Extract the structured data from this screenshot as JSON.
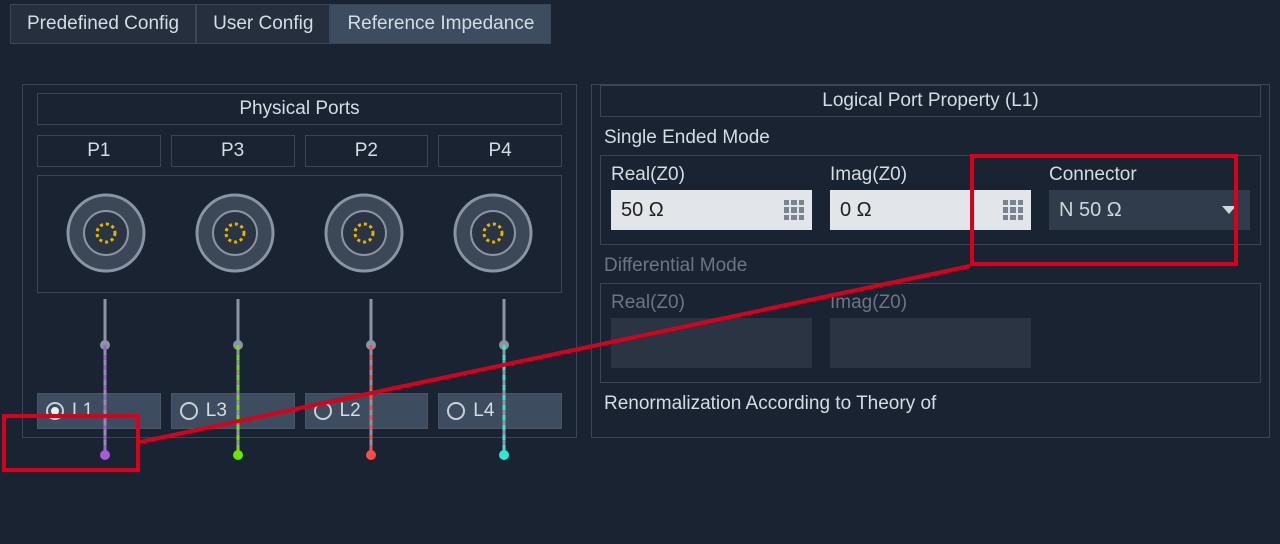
{
  "tabs": [
    {
      "label": "Predefined Config",
      "active": false
    },
    {
      "label": "User Config",
      "active": false
    },
    {
      "label": "Reference Impedance",
      "active": true
    }
  ],
  "physical_ports": {
    "title": "Physical Ports",
    "ports": [
      "P1",
      "P3",
      "P2",
      "P4"
    ]
  },
  "logical_ports": [
    {
      "label": "L1",
      "checked": true,
      "color": "#a85bd6"
    },
    {
      "label": "L3",
      "checked": false,
      "color": "#6fe400"
    },
    {
      "label": "L2",
      "checked": false,
      "color": "#ff4b4b"
    },
    {
      "label": "L4",
      "checked": false,
      "color": "#35e6d0"
    }
  ],
  "property": {
    "title": "Logical Port Property (L1)",
    "single": {
      "label": "Single Ended Mode",
      "real": {
        "label": "Real(Z0)",
        "value": "50 Ω"
      },
      "imag": {
        "label": "Imag(Z0)",
        "value": "0 Ω"
      },
      "connector": {
        "label": "Connector",
        "value": "N 50 Ω"
      }
    },
    "diff": {
      "label": "Differential Mode",
      "real": {
        "label": "Real(Z0)"
      },
      "imag": {
        "label": "Imag(Z0)"
      }
    },
    "renorm": {
      "label": "Renormalization According to Theory of"
    }
  }
}
